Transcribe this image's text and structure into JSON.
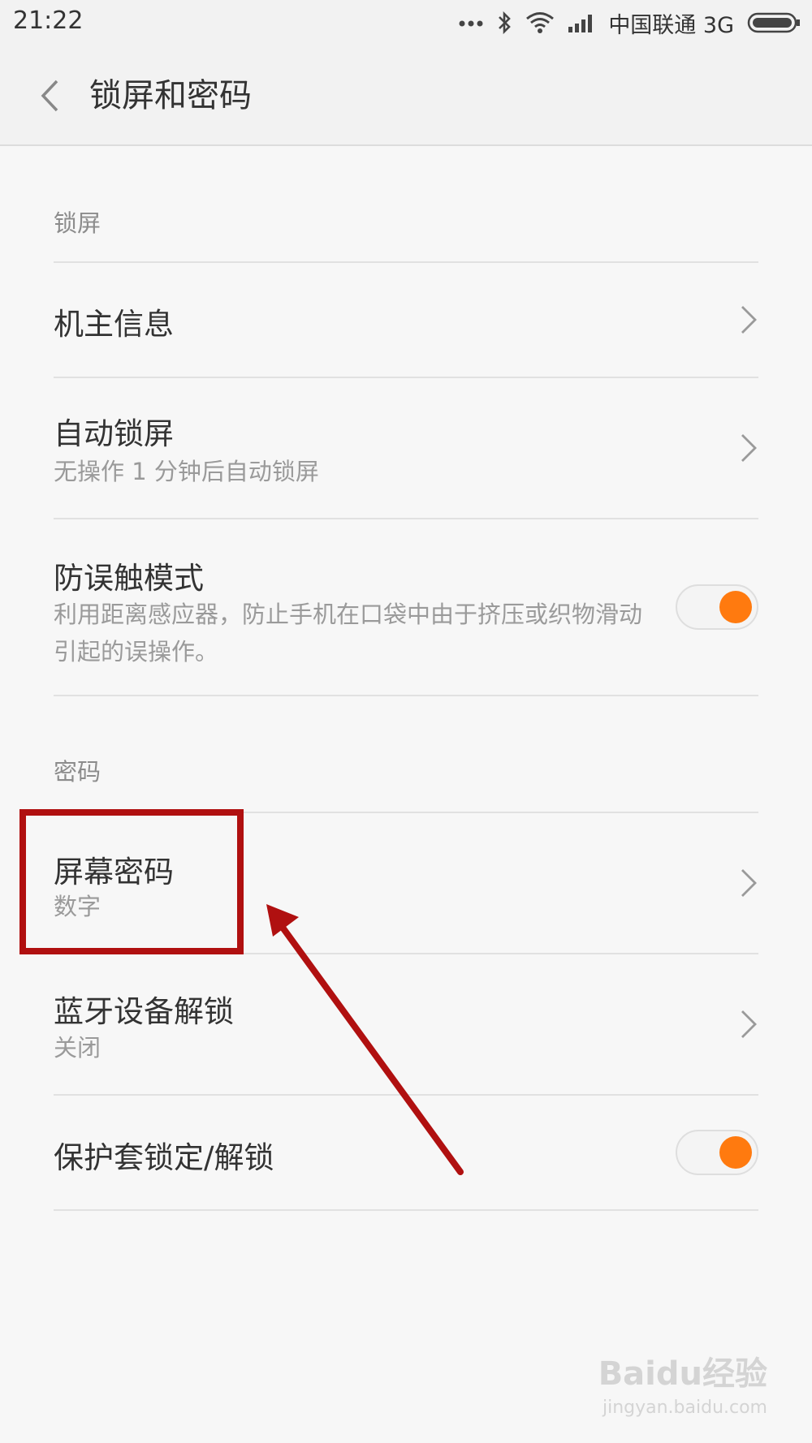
{
  "status_bar": {
    "time": "21:22",
    "carrier": "中国联通 3G",
    "icons": [
      "more-dots-icon",
      "bluetooth-icon",
      "wifi-icon",
      "signal-icon",
      "battery-icon"
    ]
  },
  "app_bar": {
    "title": "锁屏和密码",
    "back_icon": "chevron-left-icon"
  },
  "sections": {
    "lock_screen": {
      "header": "锁屏",
      "owner_info": {
        "title": "机主信息"
      },
      "auto_lock": {
        "title": "自动锁屏",
        "subtitle": "无操作 1 分钟后自动锁屏"
      },
      "anti_mistouch": {
        "title": "防误触模式",
        "subtitle": "利用距离感应器，防止手机在口袋中由于挤压或织物滑动引起的误操作。",
        "enabled": true
      }
    },
    "password": {
      "header": "密码",
      "screen_password": {
        "title": "屏幕密码",
        "subtitle": "数字"
      },
      "bluetooth_unlock": {
        "title": "蓝牙设备解锁",
        "subtitle": "关闭"
      },
      "cover_lock": {
        "title": "保护套锁定/解锁",
        "enabled": true
      }
    }
  },
  "watermark": {
    "brand": "Baidu经验",
    "url": "jingyan.baidu.com"
  },
  "colors": {
    "accent": "#ff7a0f",
    "annotation": "#b01010",
    "background": "#f7f7f7"
  }
}
